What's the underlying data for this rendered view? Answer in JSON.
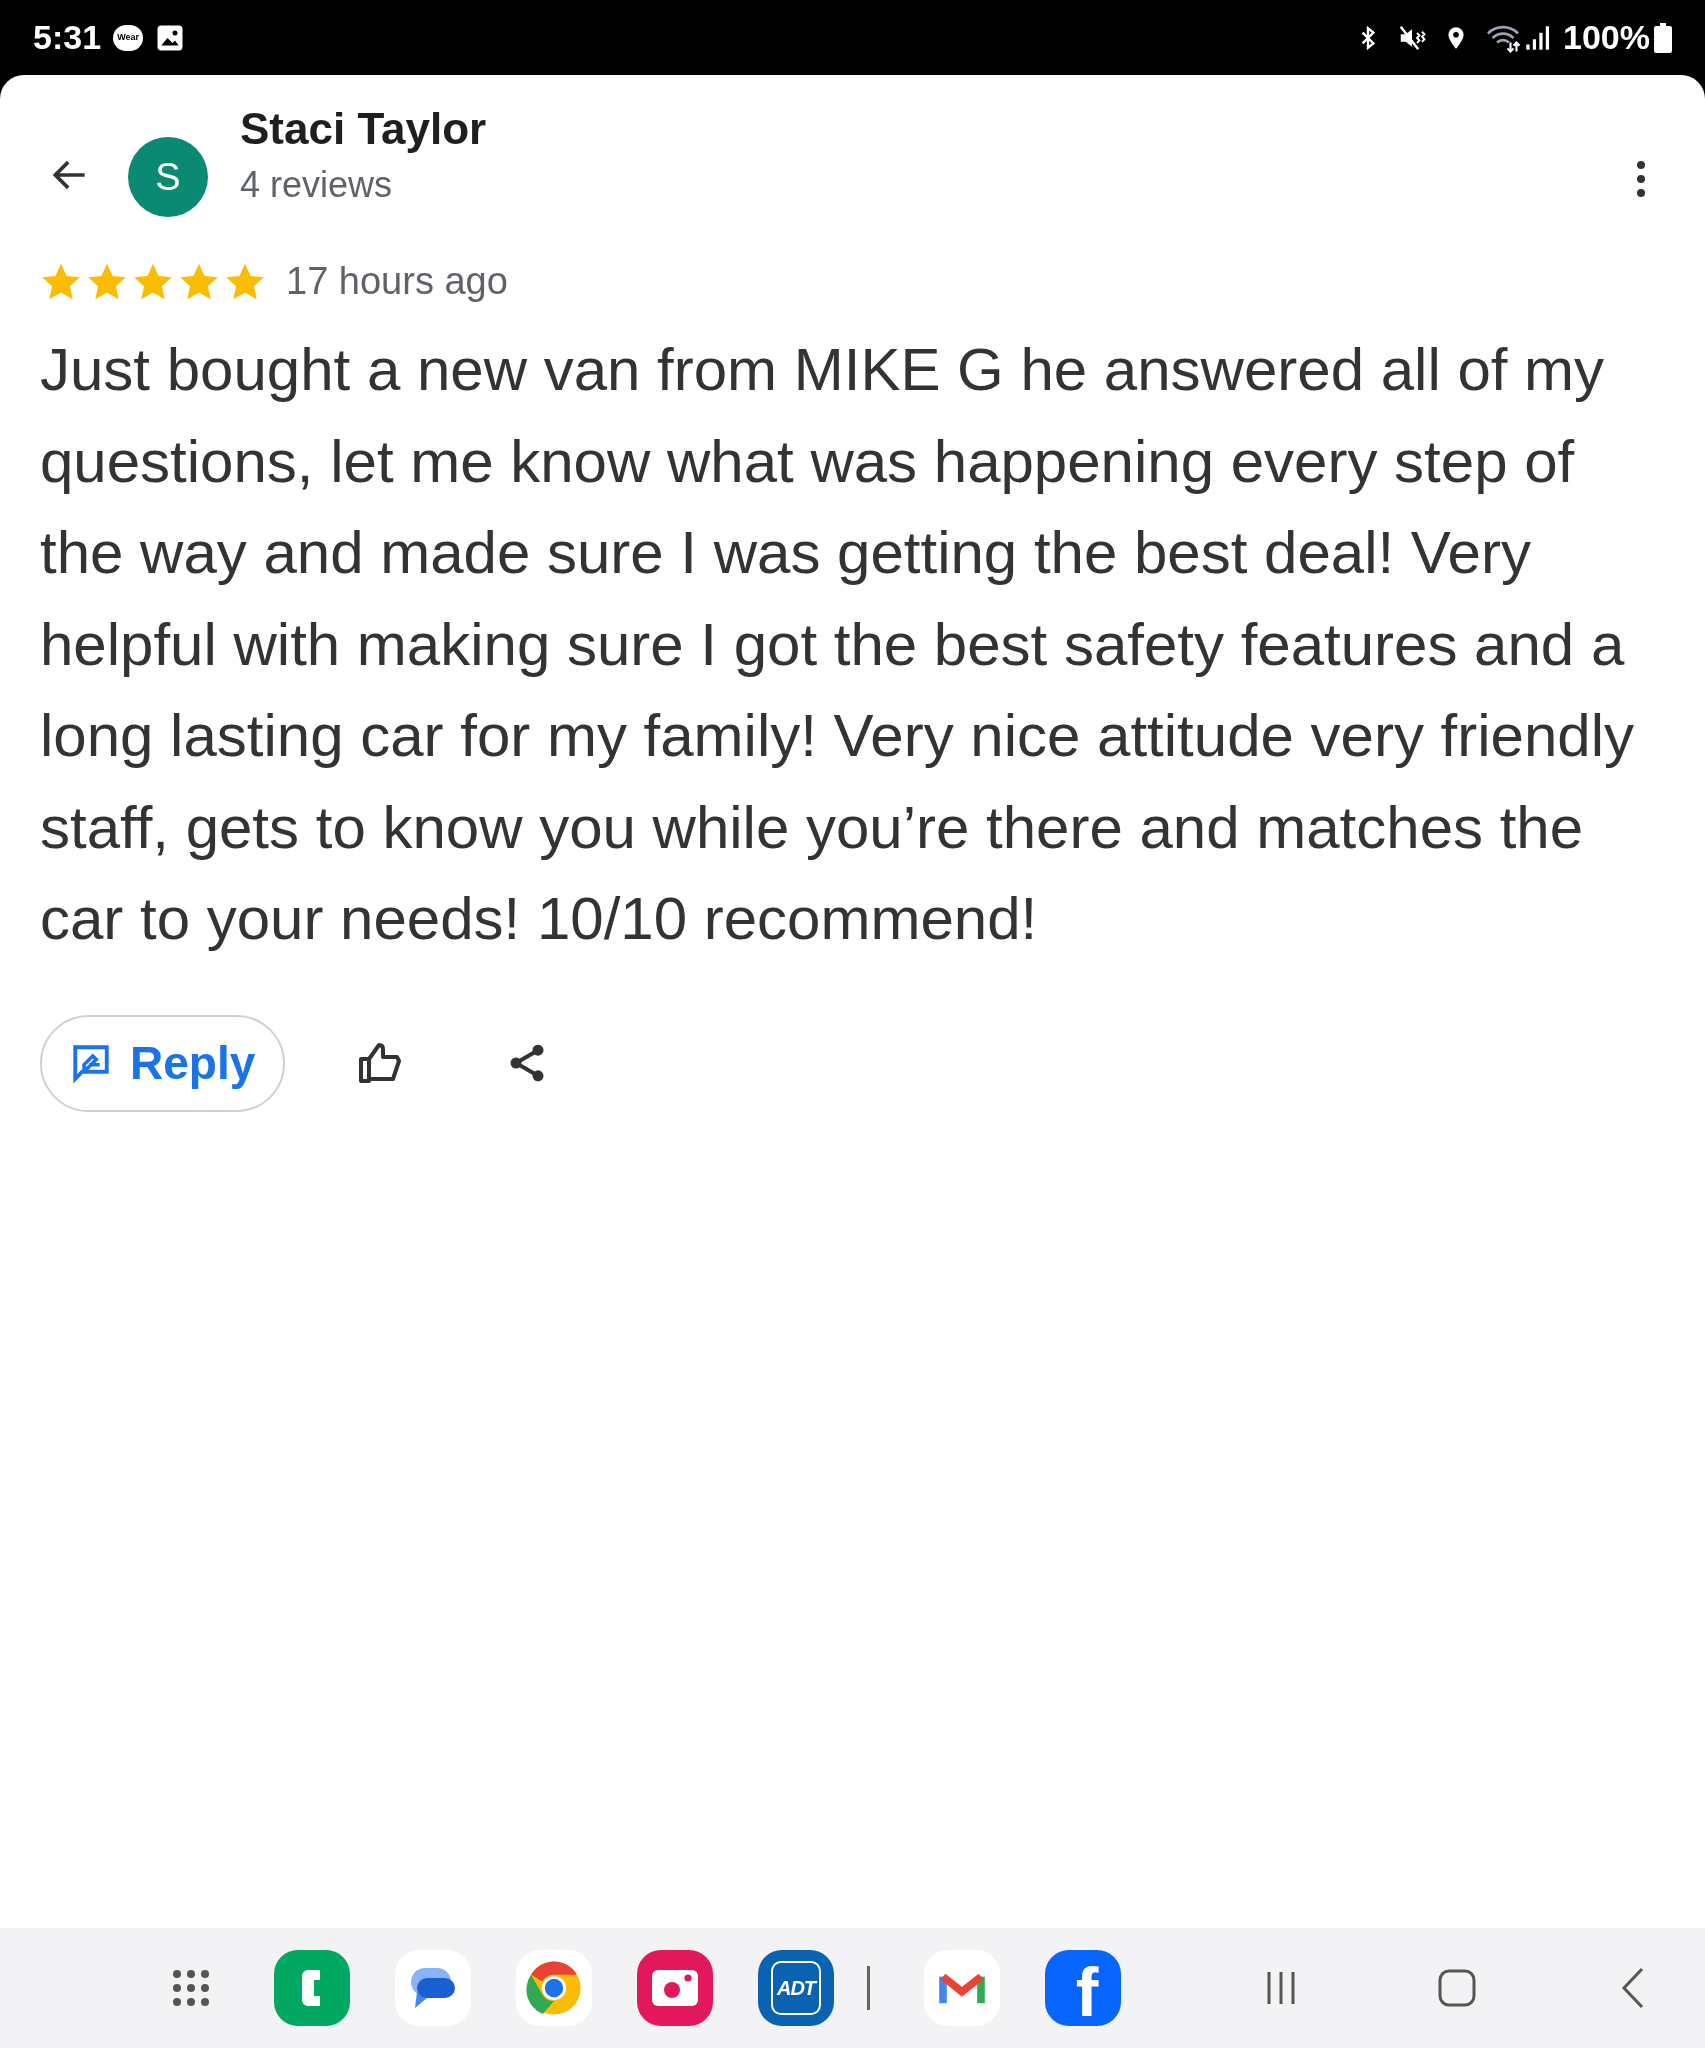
{
  "status_bar": {
    "time": "5:31",
    "wear_badge": "Wear",
    "battery": "100%"
  },
  "reviewer": {
    "avatar_letter": "S",
    "name": "Staci Taylor",
    "review_count": "4 reviews"
  },
  "review": {
    "stars": 5,
    "time": "17 hours ago",
    "text": "Just bought a new van from MIKE G he answered all of my questions, let me know what was happening every step of the way and made sure I was getting the best deal! Very helpful with making sure I got the best safety features and a long lasting car for my family! Very nice attitude very friendly staff, gets to know you while you’re there and matches the car to your needs! 10/10 recommend!"
  },
  "actions": {
    "reply_label": "Reply"
  },
  "dock": {
    "apps": [
      {
        "kind": "grid"
      },
      {
        "kind": "phone"
      },
      {
        "kind": "messages"
      },
      {
        "kind": "chrome"
      },
      {
        "kind": "camera"
      },
      {
        "kind": "badge",
        "label": "ADT"
      },
      {
        "kind": "separator"
      },
      {
        "kind": "gmail"
      },
      {
        "kind": "letter",
        "label": "f"
      }
    ]
  }
}
